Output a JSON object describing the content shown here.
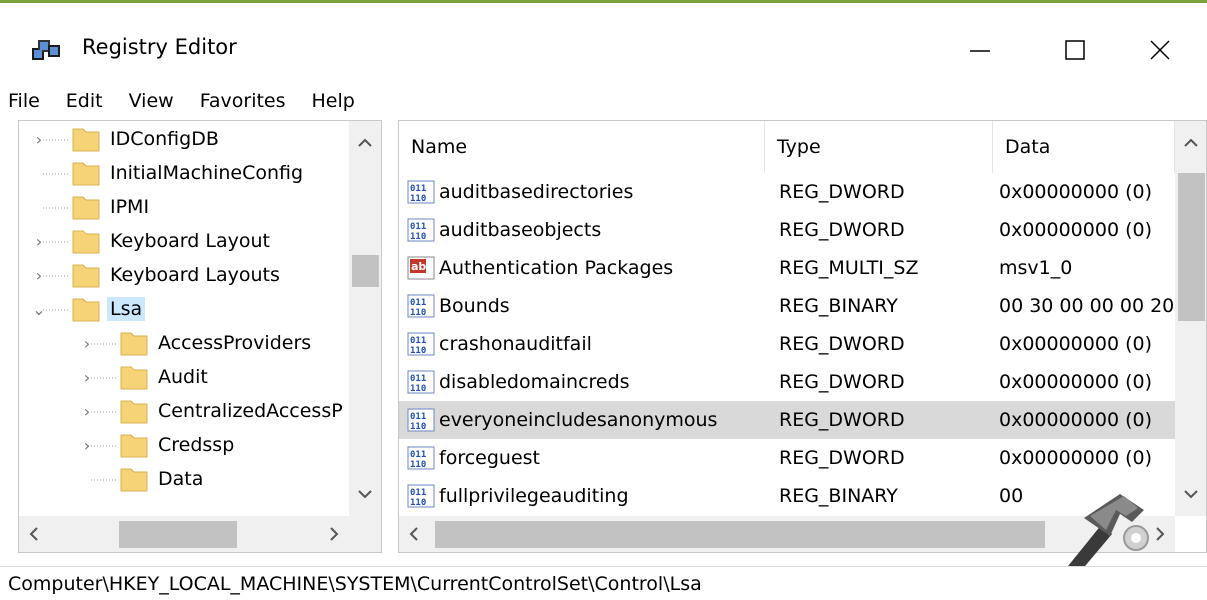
{
  "window": {
    "title": "Registry Editor"
  },
  "menu": [
    "File",
    "Edit",
    "View",
    "Favorites",
    "Help"
  ],
  "tree": [
    {
      "label": "IDConfigDB",
      "expander": "›",
      "indent": 0
    },
    {
      "label": "InitialMachineConfig",
      "expander": "",
      "indent": 0
    },
    {
      "label": "IPMI",
      "expander": "",
      "indent": 0
    },
    {
      "label": "Keyboard Layout",
      "expander": "›",
      "indent": 0
    },
    {
      "label": "Keyboard Layouts",
      "expander": "›",
      "indent": 0
    },
    {
      "label": "Lsa",
      "expander": "⌄",
      "indent": 0,
      "selected": true
    },
    {
      "label": "AccessProviders",
      "expander": "›",
      "indent": 1
    },
    {
      "label": "Audit",
      "expander": "›",
      "indent": 1
    },
    {
      "label": "CentralizedAccessP",
      "expander": "›",
      "indent": 1
    },
    {
      "label": "Credssp",
      "expander": "›",
      "indent": 1
    },
    {
      "label": "Data",
      "expander": "",
      "indent": 1
    }
  ],
  "columns": {
    "name": "Name",
    "type": "Type",
    "data": "Data"
  },
  "values": [
    {
      "name": "auditbasedirectories",
      "type": "REG_DWORD",
      "data": "0x00000000 (0)",
      "icon": "binary-value-icon"
    },
    {
      "name": "auditbaseobjects",
      "type": "REG_DWORD",
      "data": "0x00000000 (0)",
      "icon": "binary-value-icon"
    },
    {
      "name": "Authentication Packages",
      "type": "REG_MULTI_SZ",
      "data": "msv1_0",
      "icon": "string-value-icon"
    },
    {
      "name": "Bounds",
      "type": "REG_BINARY",
      "data": "00 30 00 00 00 20",
      "icon": "binary-value-icon"
    },
    {
      "name": "crashonauditfail",
      "type": "REG_DWORD",
      "data": "0x00000000 (0)",
      "icon": "binary-value-icon"
    },
    {
      "name": "disabledomaincreds",
      "type": "REG_DWORD",
      "data": "0x00000000 (0)",
      "icon": "binary-value-icon"
    },
    {
      "name": "everyoneincludesanonymous",
      "type": "REG_DWORD",
      "data": "0x00000000 (0)",
      "icon": "binary-value-icon",
      "selected": true
    },
    {
      "name": "forceguest",
      "type": "REG_DWORD",
      "data": "0x00000000 (0)",
      "icon": "binary-value-icon"
    },
    {
      "name": "fullprivilegeauditing",
      "type": "REG_BINARY",
      "data": "00",
      "icon": "binary-value-icon"
    }
  ],
  "status": {
    "path": "Computer\\HKEY_LOCAL_MACHINE\\SYSTEM\\CurrentControlSet\\Control\\Lsa"
  },
  "colors": {
    "accent_border": "#7aa33a",
    "selection_tree": "#cce8ff",
    "selection_list": "#d9d9d9",
    "folder": "#f6d377"
  }
}
